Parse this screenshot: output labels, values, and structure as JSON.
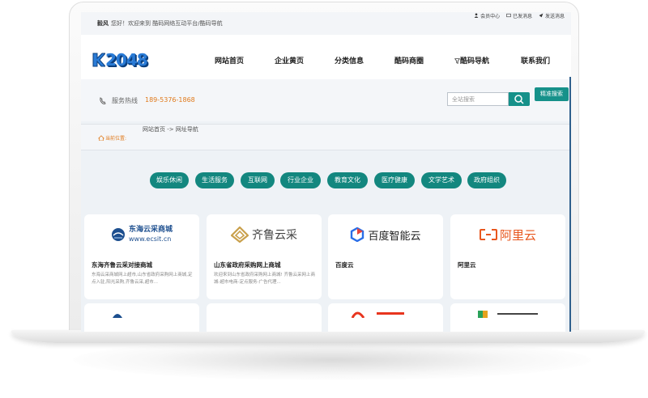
{
  "topbar": {
    "user": "毅风",
    "welcome": "您好！欢迎来到 酷码网络互动平台/酷码导航",
    "links": [
      "会员中心",
      "已发消息",
      "发送消息"
    ]
  },
  "header": {
    "logo_text": "2048",
    "nav": [
      "网站首页",
      "企业黄页",
      "分类信息",
      "酷码商圈",
      "酷码导航",
      "联系我们"
    ]
  },
  "service": {
    "hotline_label": "服务热线",
    "hotline_number": "189-5376-1868",
    "search_placeholder": "全站搜索",
    "advanced_search": "精准搜索"
  },
  "breadcrumb": {
    "here": "当前位置:",
    "path": "网站首页 -> 网址导航"
  },
  "categories": [
    "娱乐休闲",
    "生活服务",
    "互联网",
    "行业企业",
    "教育文化",
    "医疗健康",
    "文学艺术",
    "政府组织"
  ],
  "cards": [
    {
      "logo_line1": "东海云采商城",
      "logo_line2": "www.ecsit.cn",
      "title": "东海齐鲁云采对接商城",
      "desc": "东海云采商城网上超市,山东省政府采购网上商城,定点入驻,阳光采购,齐鲁云采,超市..."
    },
    {
      "logo_line1": "齐鲁云采",
      "logo_line2": "",
      "title": "山东省政府采购网上商城",
      "desc": "欢迎来到山东省政府采购网上商城! 齐鲁云采网上商城-超市电商-定点服务-广告代理..."
    },
    {
      "logo_line1": "百度智能云",
      "logo_line2": "",
      "title": "百度云",
      "desc": ""
    },
    {
      "logo_line1": "阿里云",
      "logo_line2": "",
      "title": "阿里云",
      "desc": ""
    }
  ],
  "colors": {
    "accent": "#13877f",
    "brand_blue": "#2a7bd6",
    "hotline": "#e07a1c"
  }
}
